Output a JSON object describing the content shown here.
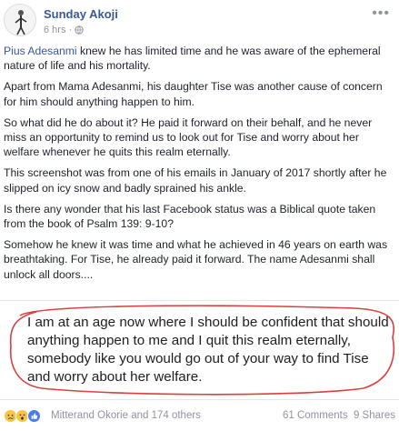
{
  "post": {
    "author": "Sunday Akoji",
    "time": "6 hrs",
    "paragraphs": [
      {
        "link": "Pius Adesanmi",
        "text": " knew he has limited time and he was aware of the ephemeral nature of life and his mortality."
      },
      {
        "text": "Apart from Mama Adesanmi, his daughter Tise was another cause of concern for him should anything happen to him."
      },
      {
        "text": "So what did he do about it? He paid it forward on their behalf, and he never miss an opportunity to remind us to look out for Tise and worry about her welfare whenever he quits this realm eternally."
      },
      {
        "text": "This screenshot was from one of his emails in January of 2017 shortly after he slipped on icy snow and badly sprained his ankle."
      },
      {
        "text": "Is there any wonder that his last Facebook status was a Biblical quote taken from the book of Psalm 139: 9-10?"
      },
      {
        "text": "Somehow he knew it was time and what he achieved in 46 years on earth was breathtaking. For Tise, he already paid it forward. The name Adesanmi shall unlock all doors...."
      }
    ],
    "quote_text": "I am at an age now where I should be confident that should anything happen to me and I quit this realm eternally, somebody like you would go out of your way to find Tise and worry about her welfare."
  },
  "footer": {
    "reactions_text": "Mitterand Okorie and 174 others",
    "comments": "61 Comments",
    "shares": "9 Shares"
  },
  "icons": {
    "globe": "globe-icon",
    "more": "more-options-icon",
    "reactions": [
      "sad-reaction-icon",
      "wow-reaction-icon",
      "like-reaction-icon"
    ]
  },
  "colors": {
    "link": "#385898",
    "muted": "#90949c",
    "ellipse": "#d9413e"
  }
}
